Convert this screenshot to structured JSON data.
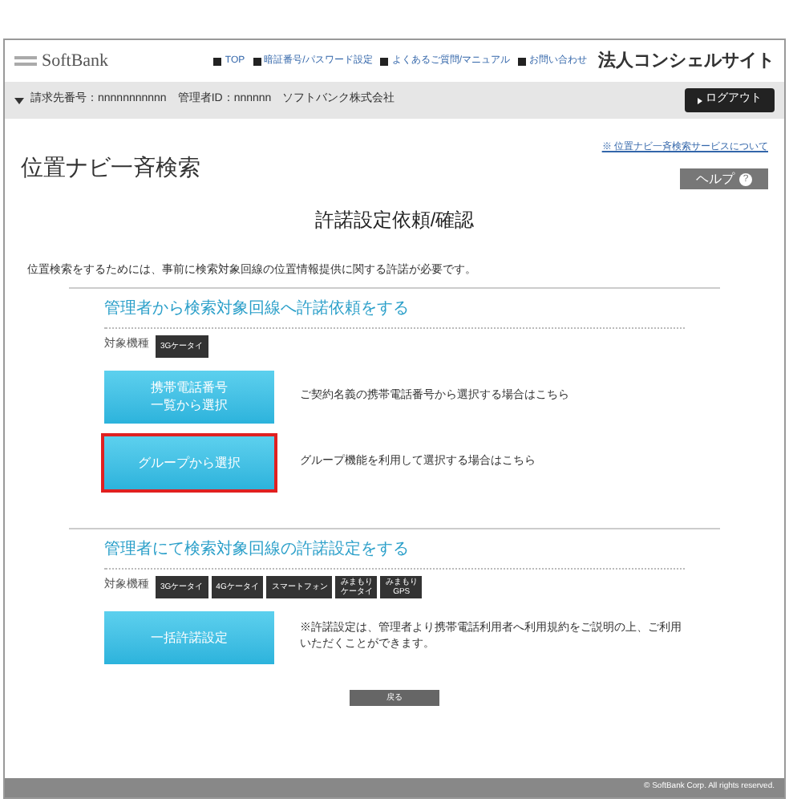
{
  "header": {
    "logo": "SoftBank",
    "nav": [
      "TOP",
      "暗証番号/パスワード設定",
      "よくあるご質問/マニュアル",
      "お問い合わせ"
    ],
    "site_title": "法人コンシェルサイト"
  },
  "account_bar": {
    "info": "請求先番号：nnnnnnnnnnn　管理者ID：nnnnnn　ソフトバンク株式会社",
    "logout": "ログアウト"
  },
  "page_title": "位置ナビ一斉検索",
  "service_link": "※ 位置ナビ一斉検索サービスについて",
  "help": "ヘルプ",
  "help_icon": "?",
  "heading": "許諾設定依頼/確認",
  "intro": "位置検索をするためには、事前に検索対象回線の位置情報提供に関する許諾が必要です。",
  "sections": [
    {
      "title": "管理者から検索対象回線へ許諾依頼をする",
      "models_label": "対象機種",
      "models": [
        [
          "3Gケータイ"
        ]
      ],
      "options": [
        {
          "button": [
            "携帯電話番号",
            "一覧から選択"
          ],
          "description": "ご契約名義の携帯電話番号から選択する場合はこちら",
          "highlighted": false
        },
        {
          "button": [
            "グループから選択"
          ],
          "description": "グループ機能を利用して選択する場合はこちら",
          "highlighted": true
        }
      ]
    },
    {
      "title": "管理者にて検索対象回線の許諾設定をする",
      "models_label": "対象機種",
      "models": [
        [
          "3Gケータイ"
        ],
        [
          "4Gケータイ"
        ],
        [
          "スマートフォン"
        ],
        [
          "みまもり",
          "ケータイ"
        ],
        [
          "みまもり",
          "GPS"
        ]
      ],
      "options": [
        {
          "button": [
            "一括許諾設定"
          ],
          "description": "※許諾設定は、管理者より携帯電話利用者へ利用規約をご説明の上、ご利用いただくことができます。",
          "highlighted": false
        }
      ]
    }
  ],
  "back": "戻る",
  "footer": "© SoftBank Corp. All rights reserved."
}
